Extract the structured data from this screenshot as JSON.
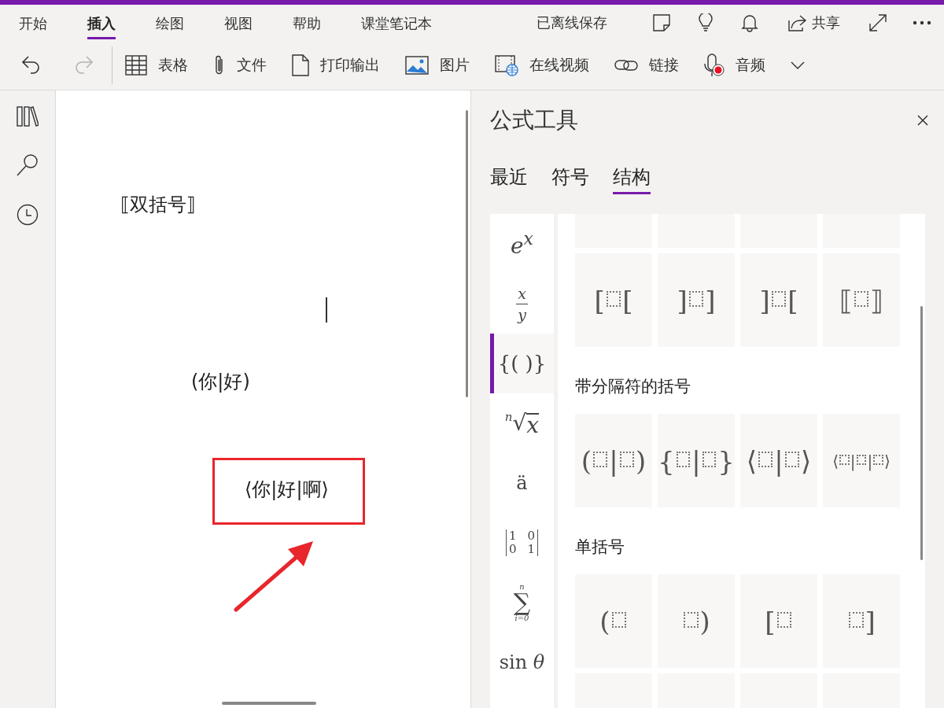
{
  "ribbon": {
    "tabs": [
      {
        "label": "开始",
        "selected": false
      },
      {
        "label": "插入",
        "selected": true
      },
      {
        "label": "绘图",
        "selected": false
      },
      {
        "label": "视图",
        "selected": false
      },
      {
        "label": "帮助",
        "selected": false
      },
      {
        "label": "课堂笔记本",
        "selected": false
      }
    ],
    "status": "已离线保存",
    "share": "共享",
    "undo": {
      "disabled": false
    },
    "redo": {
      "disabled": true
    },
    "tools": [
      {
        "label": "表格"
      },
      {
        "label": "文件"
      },
      {
        "label": "打印输出"
      },
      {
        "label": "图片"
      },
      {
        "label": "在线视频"
      },
      {
        "label": "链接"
      },
      {
        "label": "音频"
      }
    ]
  },
  "page": {
    "equations": [
      {
        "text": "⟦双括号⟧",
        "highlighted": false
      },
      {
        "text": "(你|好)",
        "highlighted": false
      },
      {
        "text": "⟨你|好|啊⟩",
        "highlighted": true
      }
    ],
    "cursor_visible": true,
    "annotations": [
      {
        "kind": "arrow"
      }
    ]
  },
  "panel": {
    "title": "公式工具",
    "tabs": [
      {
        "label": "最近",
        "selected": false
      },
      {
        "label": "符号",
        "selected": false
      },
      {
        "label": "结构",
        "selected": true
      }
    ],
    "categories": [
      {
        "kind": "sup",
        "base": "e",
        "sup": "x",
        "selected": false
      },
      {
        "kind": "frac",
        "num": "x",
        "den": "y",
        "selected": false
      },
      {
        "kind": "text",
        "text": "{( )}",
        "selected": true
      },
      {
        "kind": "root",
        "index": "n",
        "sign": "√",
        "radicand": "x",
        "selected": false
      },
      {
        "kind": "text",
        "text": "ä",
        "selected": false
      },
      {
        "kind": "matrix",
        "cells": [
          "1",
          "0",
          "0",
          "1"
        ],
        "selected": false
      },
      {
        "kind": "sum",
        "upper": "n",
        "sign": "∑",
        "lower": "i=0",
        "selected": false
      },
      {
        "kind": "text",
        "text": "sin *θ*",
        "selected": false
      }
    ],
    "sections": [
      {
        "tiles": [
          {
            "kind": "cut"
          },
          {
            "kind": "cut"
          },
          {
            "kind": "cut"
          },
          {
            "kind": "cut"
          },
          {
            "kind": "formula",
            "parts": [
              {
                "kind": "char",
                "text": "["
              },
              {
                "kind": "slot"
              },
              {
                "kind": "char",
                "text": "["
              }
            ]
          },
          {
            "kind": "formula",
            "parts": [
              {
                "kind": "char",
                "text": "]"
              },
              {
                "kind": "slot"
              },
              {
                "kind": "char",
                "text": "]"
              }
            ]
          },
          {
            "kind": "formula",
            "parts": [
              {
                "kind": "char",
                "text": "]"
              },
              {
                "kind": "slot"
              },
              {
                "kind": "char",
                "text": "["
              }
            ]
          },
          {
            "kind": "formula",
            "parts": [
              {
                "kind": "char",
                "text": "⟦"
              },
              {
                "kind": "slot"
              },
              {
                "kind": "char",
                "text": "⟧"
              }
            ]
          }
        ]
      },
      {
        "heading": "带分隔符的括号",
        "tiles": [
          {
            "kind": "formula",
            "parts": [
              {
                "kind": "char",
                "text": "("
              },
              {
                "kind": "slot"
              },
              {
                "kind": "char",
                "text": "|"
              },
              {
                "kind": "slot"
              },
              {
                "kind": "char",
                "text": ")"
              }
            ]
          },
          {
            "kind": "formula",
            "parts": [
              {
                "kind": "char",
                "text": "{"
              },
              {
                "kind": "slot"
              },
              {
                "kind": "char",
                "text": "|"
              },
              {
                "kind": "slot"
              },
              {
                "kind": "char",
                "text": "}"
              }
            ]
          },
          {
            "kind": "formula",
            "parts": [
              {
                "kind": "char",
                "text": "⟨"
              },
              {
                "kind": "slot"
              },
              {
                "kind": "char",
                "text": "|"
              },
              {
                "kind": "slot"
              },
              {
                "kind": "char",
                "text": "⟩"
              }
            ]
          },
          {
            "kind": "formula",
            "parts": [
              {
                "kind": "char",
                "text": "⟨"
              },
              {
                "kind": "slot"
              },
              {
                "kind": "char",
                "text": "|"
              },
              {
                "kind": "slot"
              },
              {
                "kind": "char",
                "text": "|"
              },
              {
                "kind": "slot"
              },
              {
                "kind": "char",
                "text": "⟩"
              }
            ]
          }
        ]
      },
      {
        "heading": "单括号",
        "tiles": [
          {
            "kind": "formula",
            "parts": [
              {
                "kind": "char",
                "text": "("
              },
              {
                "kind": "slot"
              }
            ]
          },
          {
            "kind": "formula",
            "parts": [
              {
                "kind": "slot"
              },
              {
                "kind": "char",
                "text": ")"
              }
            ]
          },
          {
            "kind": "formula",
            "parts": [
              {
                "kind": "char",
                "text": "["
              },
              {
                "kind": "slot"
              }
            ]
          },
          {
            "kind": "formula",
            "parts": [
              {
                "kind": "slot"
              },
              {
                "kind": "char",
                "text": "]"
              }
            ]
          },
          {
            "kind": "blank"
          },
          {
            "kind": "blank"
          },
          {
            "kind": "blank"
          },
          {
            "kind": "blank"
          }
        ]
      }
    ]
  }
}
